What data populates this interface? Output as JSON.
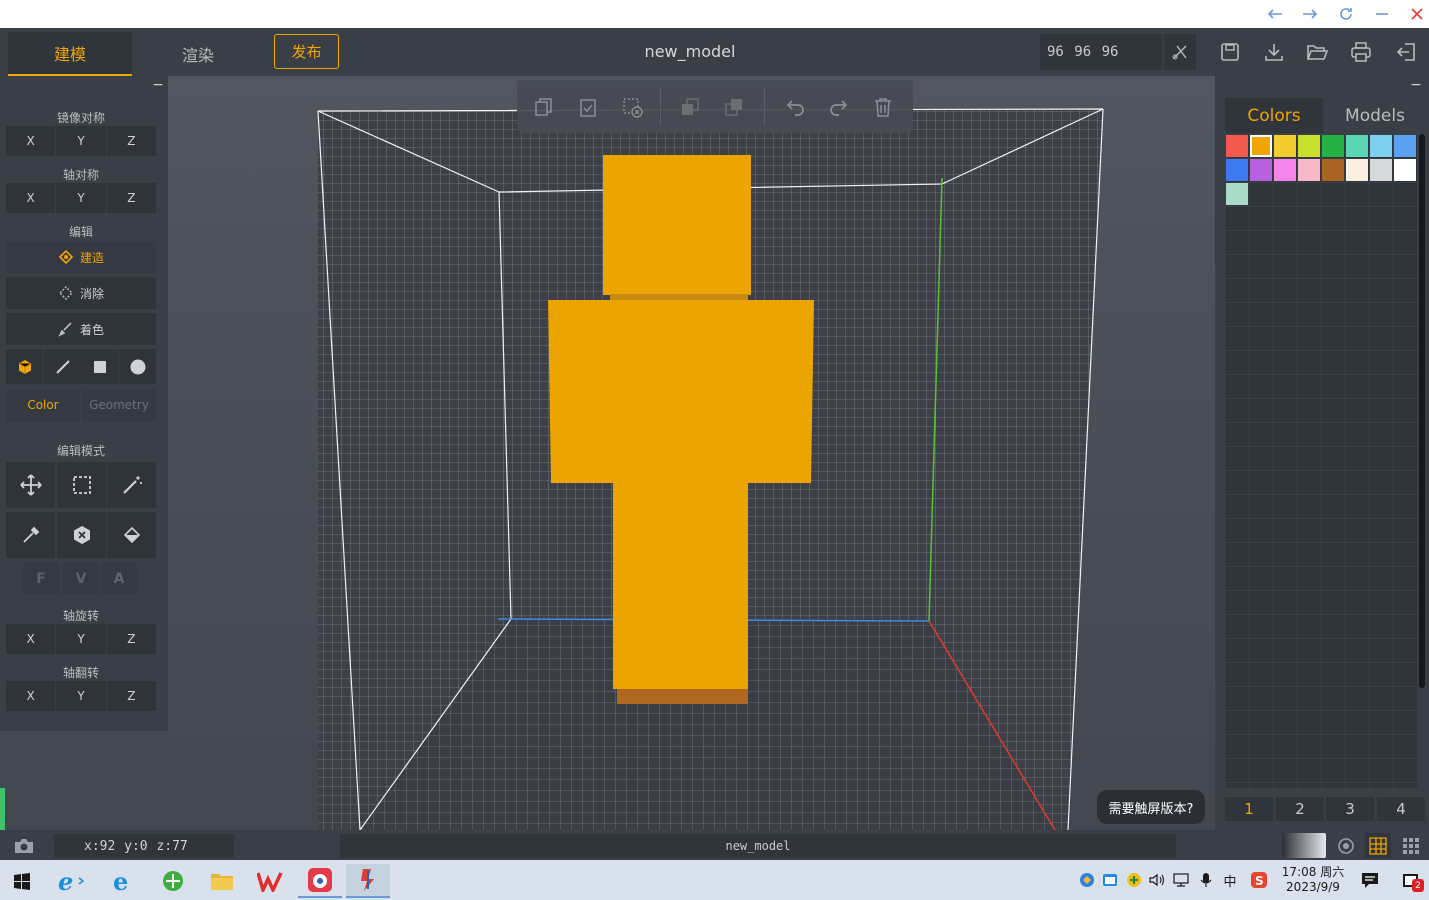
{
  "window": {
    "back_icon": "arrow-left-icon",
    "forward_icon": "arrow-right-icon",
    "reload_icon": "reload-icon",
    "minimize_icon": "minimize-icon",
    "close_icon": "close-icon"
  },
  "toolbar": {
    "tab_model": "建模",
    "tab_render": "渲染",
    "publish": "发布",
    "title": "new_model",
    "dimensions": "96 96 96",
    "icons": [
      "save-icon",
      "download-icon",
      "folder-open-icon",
      "print-icon",
      "exit-icon"
    ]
  },
  "left_panel": {
    "mirror_label": "镜像对称",
    "axis_sym_label": "轴对称",
    "edit_label": "编辑",
    "modes": [
      "建造",
      "消除",
      "着色"
    ],
    "color_tab": "Color",
    "geometry_tab": "Geometry",
    "edit_mode_label": "编辑模式",
    "fva": [
      "F",
      "V",
      "A"
    ],
    "axis_rotate_label": "轴旋转",
    "axis_flip_label": "轴翻转",
    "axes": [
      "X",
      "Y",
      "Z"
    ],
    "collapse": "−"
  },
  "float_toolbar": {
    "icons": [
      "copy-icon",
      "paste-icon",
      "clear-selection-icon",
      "layers-back-icon",
      "layers-front-icon",
      "undo-icon",
      "redo-icon",
      "delete-icon"
    ]
  },
  "right_panel": {
    "tab_colors": "Colors",
    "tab_models": "Models",
    "collapse": "−",
    "swatches": [
      "#f25a4f",
      "#f0a500",
      "#f2cd30",
      "#c8e02e",
      "#25b145",
      "#5ad6b4",
      "#7dd0ef",
      "#5aa2f0",
      "#3e78ee",
      "#b760e0",
      "#f486ea",
      "#f7b8c8",
      "#a86422",
      "#fbefe0",
      "#d6d8da",
      "#ffffff",
      "#a8dcc8"
    ],
    "selected_swatch": 1,
    "pages": [
      "1",
      "2",
      "3",
      "4"
    ],
    "active_page": 0
  },
  "tooltip": "需要触屏版本?",
  "status": {
    "coords": "x:92 y:0 z:77",
    "model_name": "new_model",
    "camera_icon": "camera-icon"
  },
  "colors": {
    "accent": "#f0a500",
    "voxel": "#eca400",
    "voxel_shadow": "#b06820"
  },
  "taskbar": {
    "apps": [
      "windows-start-icon",
      "ie-icon",
      "edge-icon",
      "green-browser-icon",
      "file-explorer-icon",
      "wps-icon",
      "app-icon",
      "voxel-app-icon"
    ],
    "time": "17:08 周六",
    "date": "2023/9/9",
    "ime": "中",
    "notification_count": "2"
  }
}
